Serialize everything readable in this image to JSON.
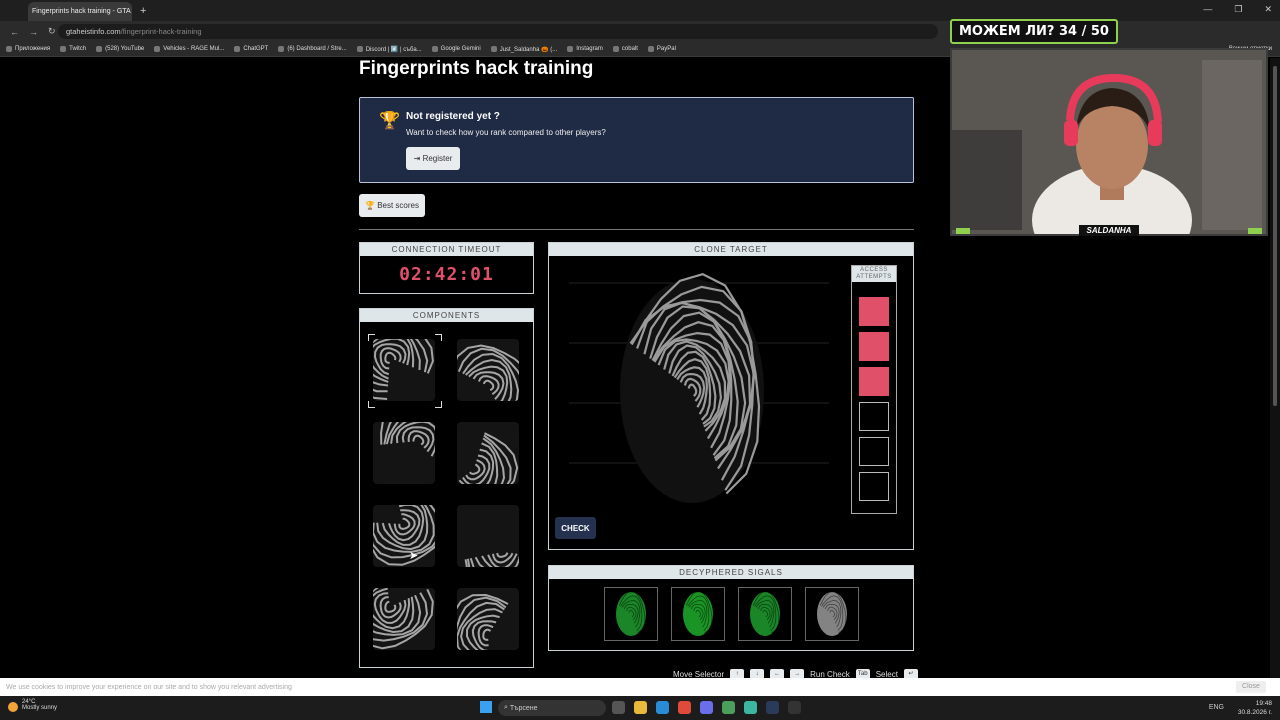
{
  "browser": {
    "tab_title": "Fingerprints hack training - GTA",
    "url_host": "gtaheistinfo.com",
    "url_path": "/fingerprint-hack-training",
    "bookmarks": [
      "Приложения",
      "Twitch",
      "(528) YouTube",
      "Vehicles - RAGE Mul...",
      "ChatGPT",
      "(6) Dashboard / Stre...",
      "Discord | #️⃣ | съба...",
      "Google Gemini",
      "Just_Saldanha 🎃 (...",
      "Instagram",
      "cobalt",
      "PayPal"
    ],
    "bookmarks_right": "Всички отметки"
  },
  "page": {
    "title": "Fingerprints hack training",
    "register_title": "Not registered yet ?",
    "register_sub": "Want to check how you rank compared to other players?",
    "register_btn": "Register",
    "best_scores": "Best scores",
    "timeout_label": "CONNECTION TIMEOUT",
    "timer": "02:42:01",
    "components_label": "COMPONENTS",
    "clone_label": "CLONE TARGET",
    "access_label": "ACCESS ATTEMPTS",
    "attempts_used": 3,
    "attempts_total": 6,
    "check_btn": "CHECK",
    "deciphered_label": "DECYPHERED SIGALS",
    "footer": {
      "move": "Move Selector",
      "keys": [
        "↑",
        "↓",
        "←",
        "→"
      ],
      "run": "Run Check",
      "run_key": "Tab",
      "select": "Select",
      "select_key": "↵"
    }
  },
  "cookie": {
    "text": "We use cookies to improve your experience on our site and to show you relevant advertising",
    "close": "Close"
  },
  "taskbar": {
    "temp": "24°C",
    "weather": "Mostly sunny",
    "search": "Търсене",
    "lang": "ENG",
    "time": "19:48",
    "date": "30.8.2026 г."
  },
  "stream": {
    "badge": "МОЖЕМ ЛИ? 34 / 50",
    "name": "SALDANHA"
  },
  "colors": {
    "accent": "#e05068",
    "panel_header": "#dfe6e9",
    "navy": "#1f2a44"
  }
}
